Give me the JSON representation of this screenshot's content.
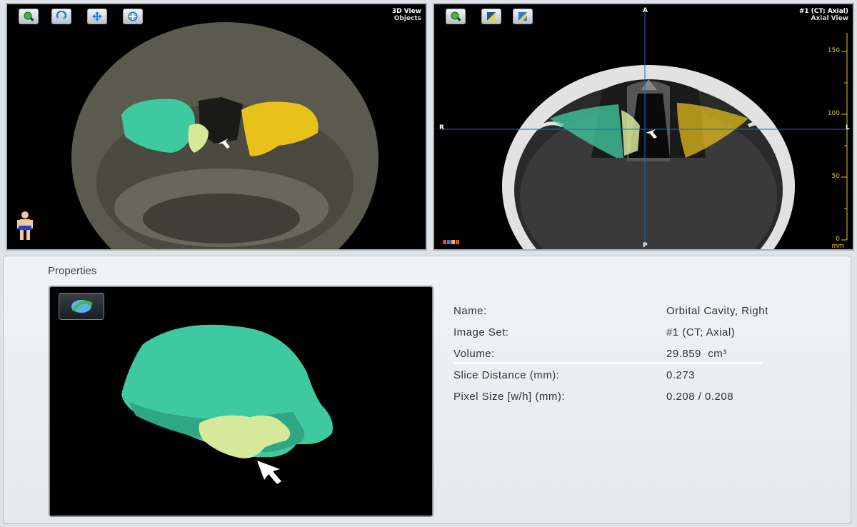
{
  "view3d": {
    "title": "3D View",
    "subtitle": "Objects",
    "toolbar": [
      {
        "icon": "zoom-icon"
      },
      {
        "icon": "rotate-icon"
      },
      {
        "icon": "pan-icon"
      },
      {
        "icon": "reset-view-icon"
      }
    ]
  },
  "axial": {
    "title": "#1 (CT; Axial)",
    "subtitle": "Axial View",
    "toolbar": [
      {
        "icon": "zoom-icon"
      },
      {
        "icon": "windowing-icon"
      },
      {
        "icon": "contrast-icon"
      }
    ],
    "orientation": {
      "top": "A",
      "bottom": "P",
      "left": "R",
      "right": "L"
    },
    "scale": {
      "labels": [
        "150",
        "100",
        "50",
        "0"
      ],
      "unit": "mm"
    }
  },
  "properties": {
    "title": "Properties",
    "rows": [
      {
        "label": "Name:",
        "value": "Orbital Cavity, Right"
      },
      {
        "label": "Image Set:",
        "value": "#1 (CT; Axial)"
      },
      {
        "label": "Volume:",
        "value": "29.859  cm³"
      },
      {
        "label": "Slice Distance (mm):",
        "value": "0.273"
      },
      {
        "label": "Pixel Size [w/h] (mm):",
        "value": "0.208 / 0.208"
      }
    ]
  },
  "colors": {
    "orbit_right": "#3fc9a0",
    "orbit_left": "#e8c21a",
    "structure_highlight": "#d6e89a",
    "crosshair": "#2b63c8",
    "scale_bar": "#e6c230"
  }
}
